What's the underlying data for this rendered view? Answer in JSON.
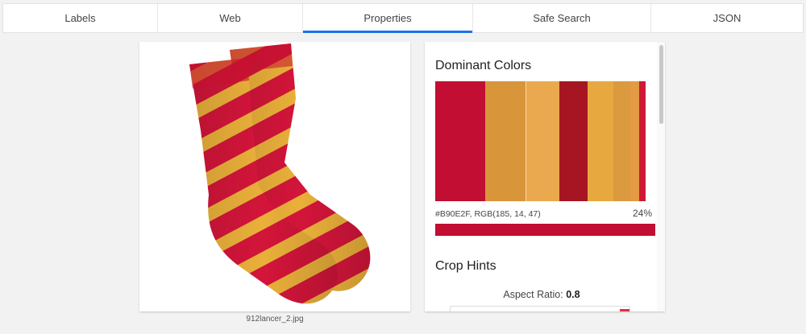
{
  "tabs": [
    {
      "label": "Labels",
      "active": false
    },
    {
      "label": "Web",
      "active": false
    },
    {
      "label": "Properties",
      "active": true
    },
    {
      "label": "Safe Search",
      "active": false
    },
    {
      "label": "JSON",
      "active": false
    }
  ],
  "image": {
    "filename": "912lancer_2.jpg",
    "subject": "red-and-yellow-striped-socks"
  },
  "properties": {
    "dominant_colors_title": "Dominant Colors",
    "color_segments": [
      {
        "color": "#c10e32",
        "fraction": 0.24
      },
      {
        "color": "#d8953a",
        "fraction": 0.19
      },
      {
        "color": "#eaa94e",
        "fraction": 0.157
      },
      {
        "color": "#a71523",
        "fraction": 0.137
      },
      {
        "color": "#e7a83f",
        "fraction": 0.122
      },
      {
        "color": "#dc9a3e",
        "fraction": 0.08
      },
      {
        "color": "#e59a45",
        "fraction": 0.045
      },
      {
        "color": "#cd1936",
        "fraction": 0.029
      }
    ],
    "selected_color_hex": "#B90E2F,",
    "selected_color_rgb": "RGB(185, 14, 47)",
    "selected_color_percent": "24%",
    "selected_color_swatch": "#c10e32",
    "crop_hints_title": "Crop Hints",
    "aspect_ratio_label": "Aspect Ratio:",
    "aspect_ratio_value": "0.8"
  }
}
